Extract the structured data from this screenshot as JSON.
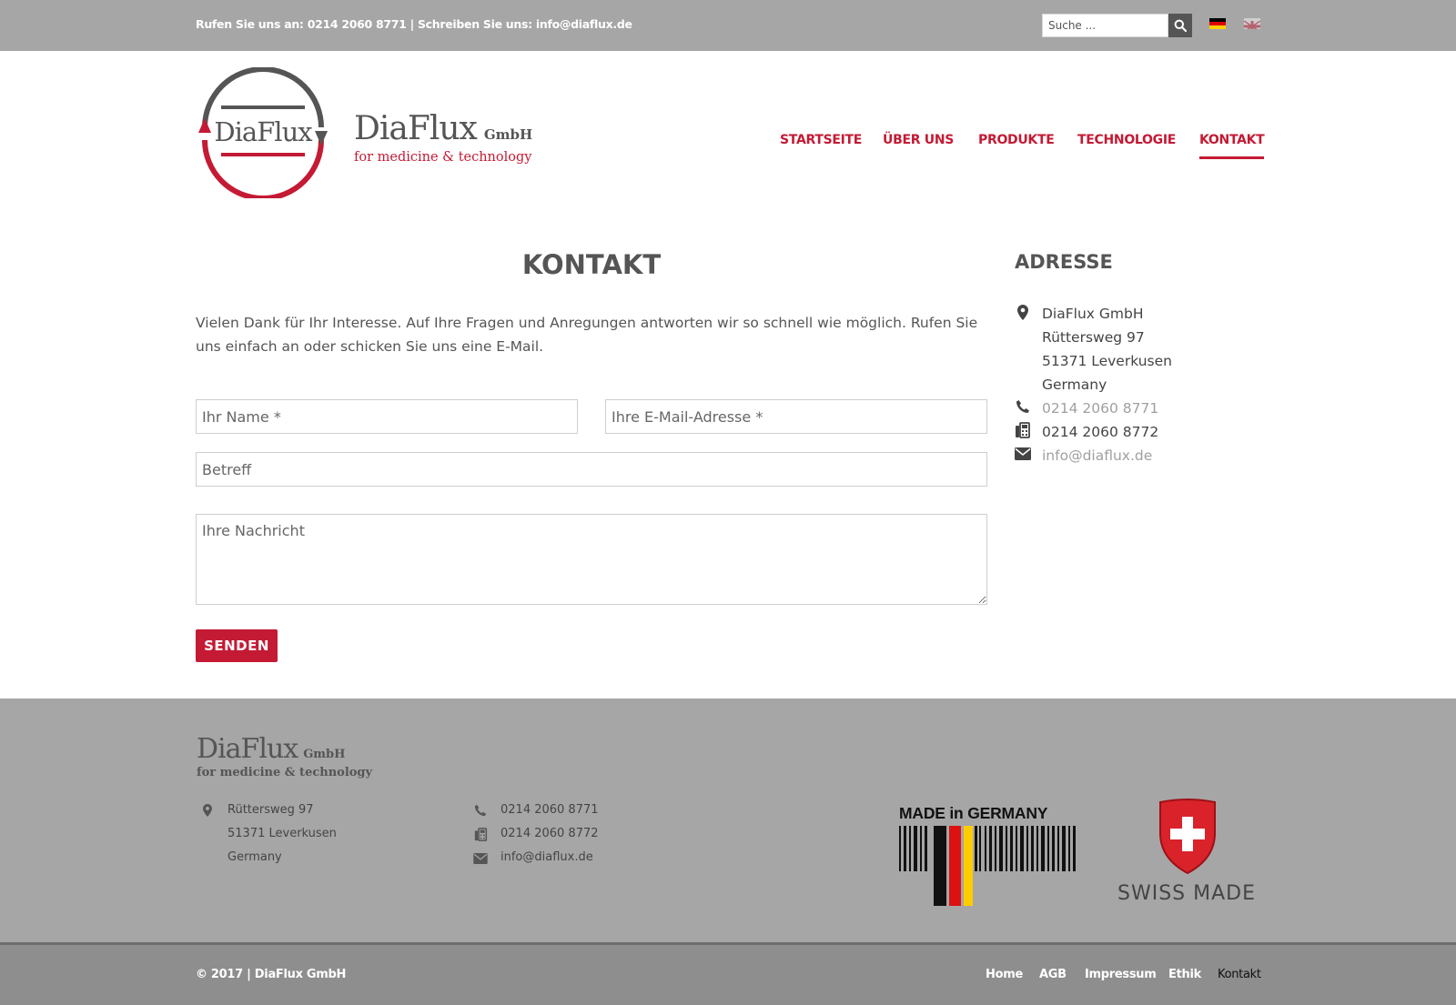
{
  "topbar": {
    "call_prefix": "Rufen Sie uns an:",
    "phone": "0214 2060 8771",
    "separator": "|",
    "write_prefix": "Schreiben Sie uns:",
    "email": "info@diaflux.de",
    "search_placeholder": "Suche ...",
    "icons": {
      "search": "search-icon",
      "de": "flag-de-icon",
      "en": "flag-uk-icon"
    }
  },
  "header": {
    "logo_text": "DiaFlux",
    "brand_name": "DiaFlux",
    "brand_suffix": "GmbH",
    "brand_tagline": "for medicine & technology",
    "nav": [
      {
        "label": "STARTSEITE"
      },
      {
        "label": "ÜBER UNS"
      },
      {
        "label": "PRODUKTE"
      },
      {
        "label": "TECHNOLOGIE"
      },
      {
        "label": "KONTAKT",
        "active": true
      }
    ]
  },
  "main": {
    "title": "KONTAKT",
    "intro": "Vielen Dank für Ihr Interesse. Auf Ihre Fragen und Anregungen antworten wir so schnell wie möglich. Rufen Sie uns einfach an oder schicken Sie uns eine E-Mail.",
    "form": {
      "name_placeholder": "Ihr Name *",
      "email_placeholder": "Ihre E-Mail-Adresse *",
      "subject_placeholder": "Betreff",
      "message_placeholder": "Ihre Nachricht",
      "submit_label": "SENDEN"
    }
  },
  "address": {
    "title": "ADRESSE",
    "company": "DiaFlux GmbH",
    "street": "Rüttersweg 97",
    "city": "51371 Leverkusen",
    "country": "Germany",
    "phone": "0214 2060 8771",
    "fax": "0214 2060 8772",
    "email": "info@diaflux.de",
    "icons": {
      "location": "map-marker-icon",
      "phone": "phone-icon",
      "fax": "fax-icon",
      "email": "envelope-icon"
    }
  },
  "footer": {
    "brand_name": "DiaFlux",
    "brand_suffix": "GmbH",
    "brand_tagline": "for medicine & technology",
    "street": "Rüttersweg 97",
    "city": "51371 Leverkusen",
    "country": "Germany",
    "phone": "0214 2060 8771",
    "fax": "0214 2060 8772",
    "email": "info@diaflux.de",
    "made_in_germany": "MADE in GERMANY",
    "swiss_made": "SWISS MADE"
  },
  "bottombar": {
    "copyright": "© 2017 | DiaFlux GmbH",
    "links": [
      {
        "label": "Home"
      },
      {
        "label": "AGB"
      },
      {
        "label": "Impressum"
      },
      {
        "label": "Ethik"
      },
      {
        "label": "Kontakt",
        "active": true
      }
    ]
  },
  "colors": {
    "accent": "#c41a34",
    "topbar_bg": "#a6a6a6",
    "footer_bg": "#a6a6a6",
    "bottombar_bg": "#8e8e8e",
    "text_dark": "#555555"
  }
}
